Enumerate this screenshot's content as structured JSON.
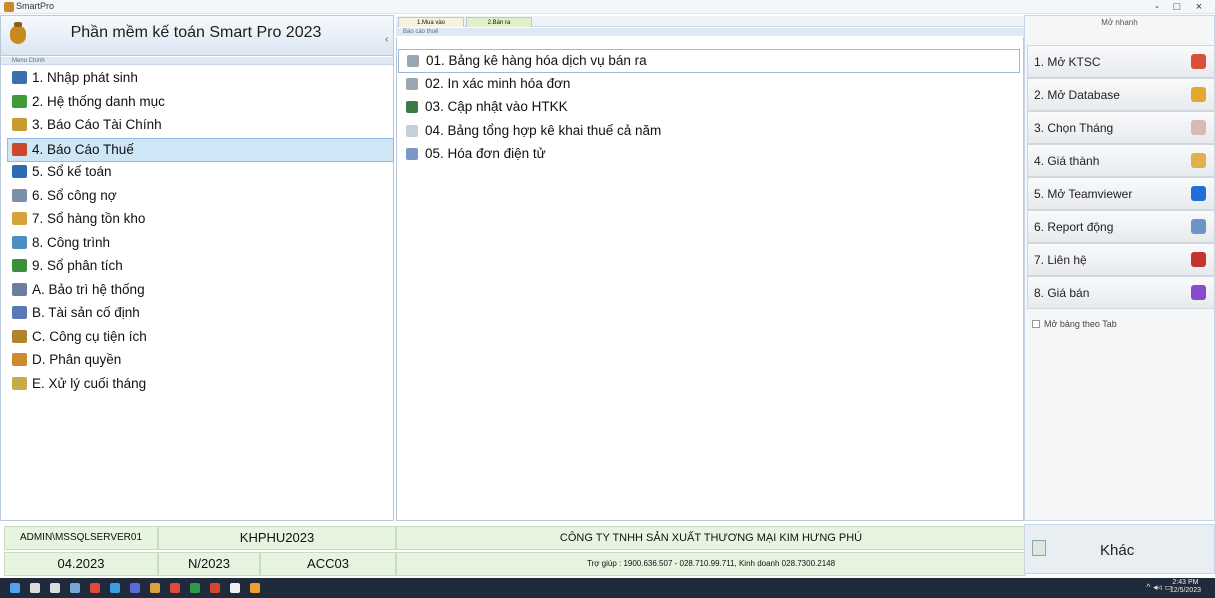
{
  "window": {
    "title": "SmartPro",
    "controls": [
      "-",
      "□",
      "×"
    ]
  },
  "left": {
    "app_name": "Phần mềm kế toán Smart Pro 2023",
    "menu_caption": "Menu Chính",
    "items": [
      {
        "label": "1. Nhập phát sinh",
        "icon": "ledger-icon",
        "color": "#3a6fb0"
      },
      {
        "label": "2. Hệ thống danh mục",
        "icon": "tree-icon",
        "color": "#3f9a3a"
      },
      {
        "label": "3. Báo Cáo Tài Chính",
        "icon": "money-icon",
        "color": "#c79a2e"
      },
      {
        "label": "4. Báo Cáo Thuế",
        "icon": "percent-icon",
        "color": "#c94a2a"
      },
      {
        "label": "5. Sổ kế toán",
        "icon": "book-icon",
        "color": "#2a6db5"
      },
      {
        "label": "6. Sổ công nợ",
        "icon": "debt-icon",
        "color": "#7b8fa8"
      },
      {
        "label": "7. Sổ hàng tồn kho",
        "icon": "inventory-icon",
        "color": "#d8a23a"
      },
      {
        "label": "8. Công trình",
        "icon": "building-icon",
        "color": "#4a8fc0"
      },
      {
        "label": "9. Sổ phân tích",
        "icon": "analysis-icon",
        "color": "#3c8f3c"
      },
      {
        "label": "A. Bảo trì hệ thống",
        "icon": "maintenance-icon",
        "color": "#6c7ea0"
      },
      {
        "label": "B. Tài sản cố định",
        "icon": "asset-icon",
        "color": "#5978b8"
      },
      {
        "label": "C. Công cụ tiện ích",
        "icon": "tools-icon",
        "color": "#b0842e"
      },
      {
        "label": "D. Phân quyền",
        "icon": "permission-icon",
        "color": "#d08a2e"
      },
      {
        "label": "E. Xử lý cuối tháng",
        "icon": "month-end-icon",
        "color": "#c9a94a"
      }
    ],
    "selected_index": 3
  },
  "middle": {
    "tabs": [
      "1.Mua vào",
      "2.Bán ra"
    ],
    "caption": "Báo cáo thuế",
    "items": [
      {
        "label": "01. Bảng kê hàng hóa dịch vụ bán ra",
        "icon": "doc-icon",
        "color": "#9aa6b2"
      },
      {
        "label": "02. In xác minh hóa đơn",
        "icon": "doc-icon",
        "color": "#9aa6b2"
      },
      {
        "label": "03. Cập nhật vào HTKK",
        "icon": "htkk-icon",
        "color": "#3e7a4a"
      },
      {
        "label": "04. Bảng tổng hợp kê khai thuế cả năm",
        "icon": "summary-icon",
        "color": "#c7cfd8"
      },
      {
        "label": "05. Hóa đơn điện tử",
        "icon": "einvoice-icon",
        "color": "#7c96c8"
      }
    ],
    "selected_index": 0
  },
  "right": {
    "header": "Mở nhanh",
    "buttons": [
      {
        "label": "1. Mở KTSC",
        "icon": "chrome-icon",
        "color": "#d9503a"
      },
      {
        "label": "2. Mở Database",
        "icon": "database-icon",
        "color": "#e3a82e"
      },
      {
        "label": "3. Chọn Tháng",
        "icon": "calendar-icon",
        "color": "#d9b8b8"
      },
      {
        "label": "4. Giá thành",
        "icon": "sigma-icon",
        "color": "#e2b04a"
      },
      {
        "label": "5. Mở Teamviewer",
        "icon": "teamviewer-icon",
        "color": "#1e6fd9"
      },
      {
        "label": "6. Report động",
        "icon": "report-icon",
        "color": "#6c94c8"
      },
      {
        "label": "7. Liên hệ",
        "icon": "phone-icon",
        "color": "#c7342e"
      },
      {
        "label": "8. Giá bán",
        "icon": "price-icon",
        "color": "#8a4ad0"
      }
    ],
    "tab_checkbox_label": "Mở bảng theo Tab"
  },
  "status": {
    "server": "ADMIN\\MSSQLSERVER01",
    "database": "KHPHU2023",
    "period": "04.2023",
    "year_code": "N/2023",
    "account": "ACC03",
    "company": "CÔNG TY TNHH SẢN XUẤT THƯƠNG MẠI KIM HƯNG PHÚ",
    "hotline": "Trợ giúp : 1900.636.507 - 028.710.99.711, Kinh doanh 028.7300.2148",
    "other_button": "Khác"
  },
  "taskbar": {
    "time": "2:43 PM",
    "date": "12/5/2023",
    "icons": [
      "windows-icon",
      "search-icon",
      "task-view-icon",
      "app-icon",
      "chrome-icon",
      "edge-icon",
      "teams-icon",
      "user-icon",
      "chrome-icon",
      "excel-icon",
      "app-icon",
      "file-icon",
      "diamond-icon"
    ]
  }
}
